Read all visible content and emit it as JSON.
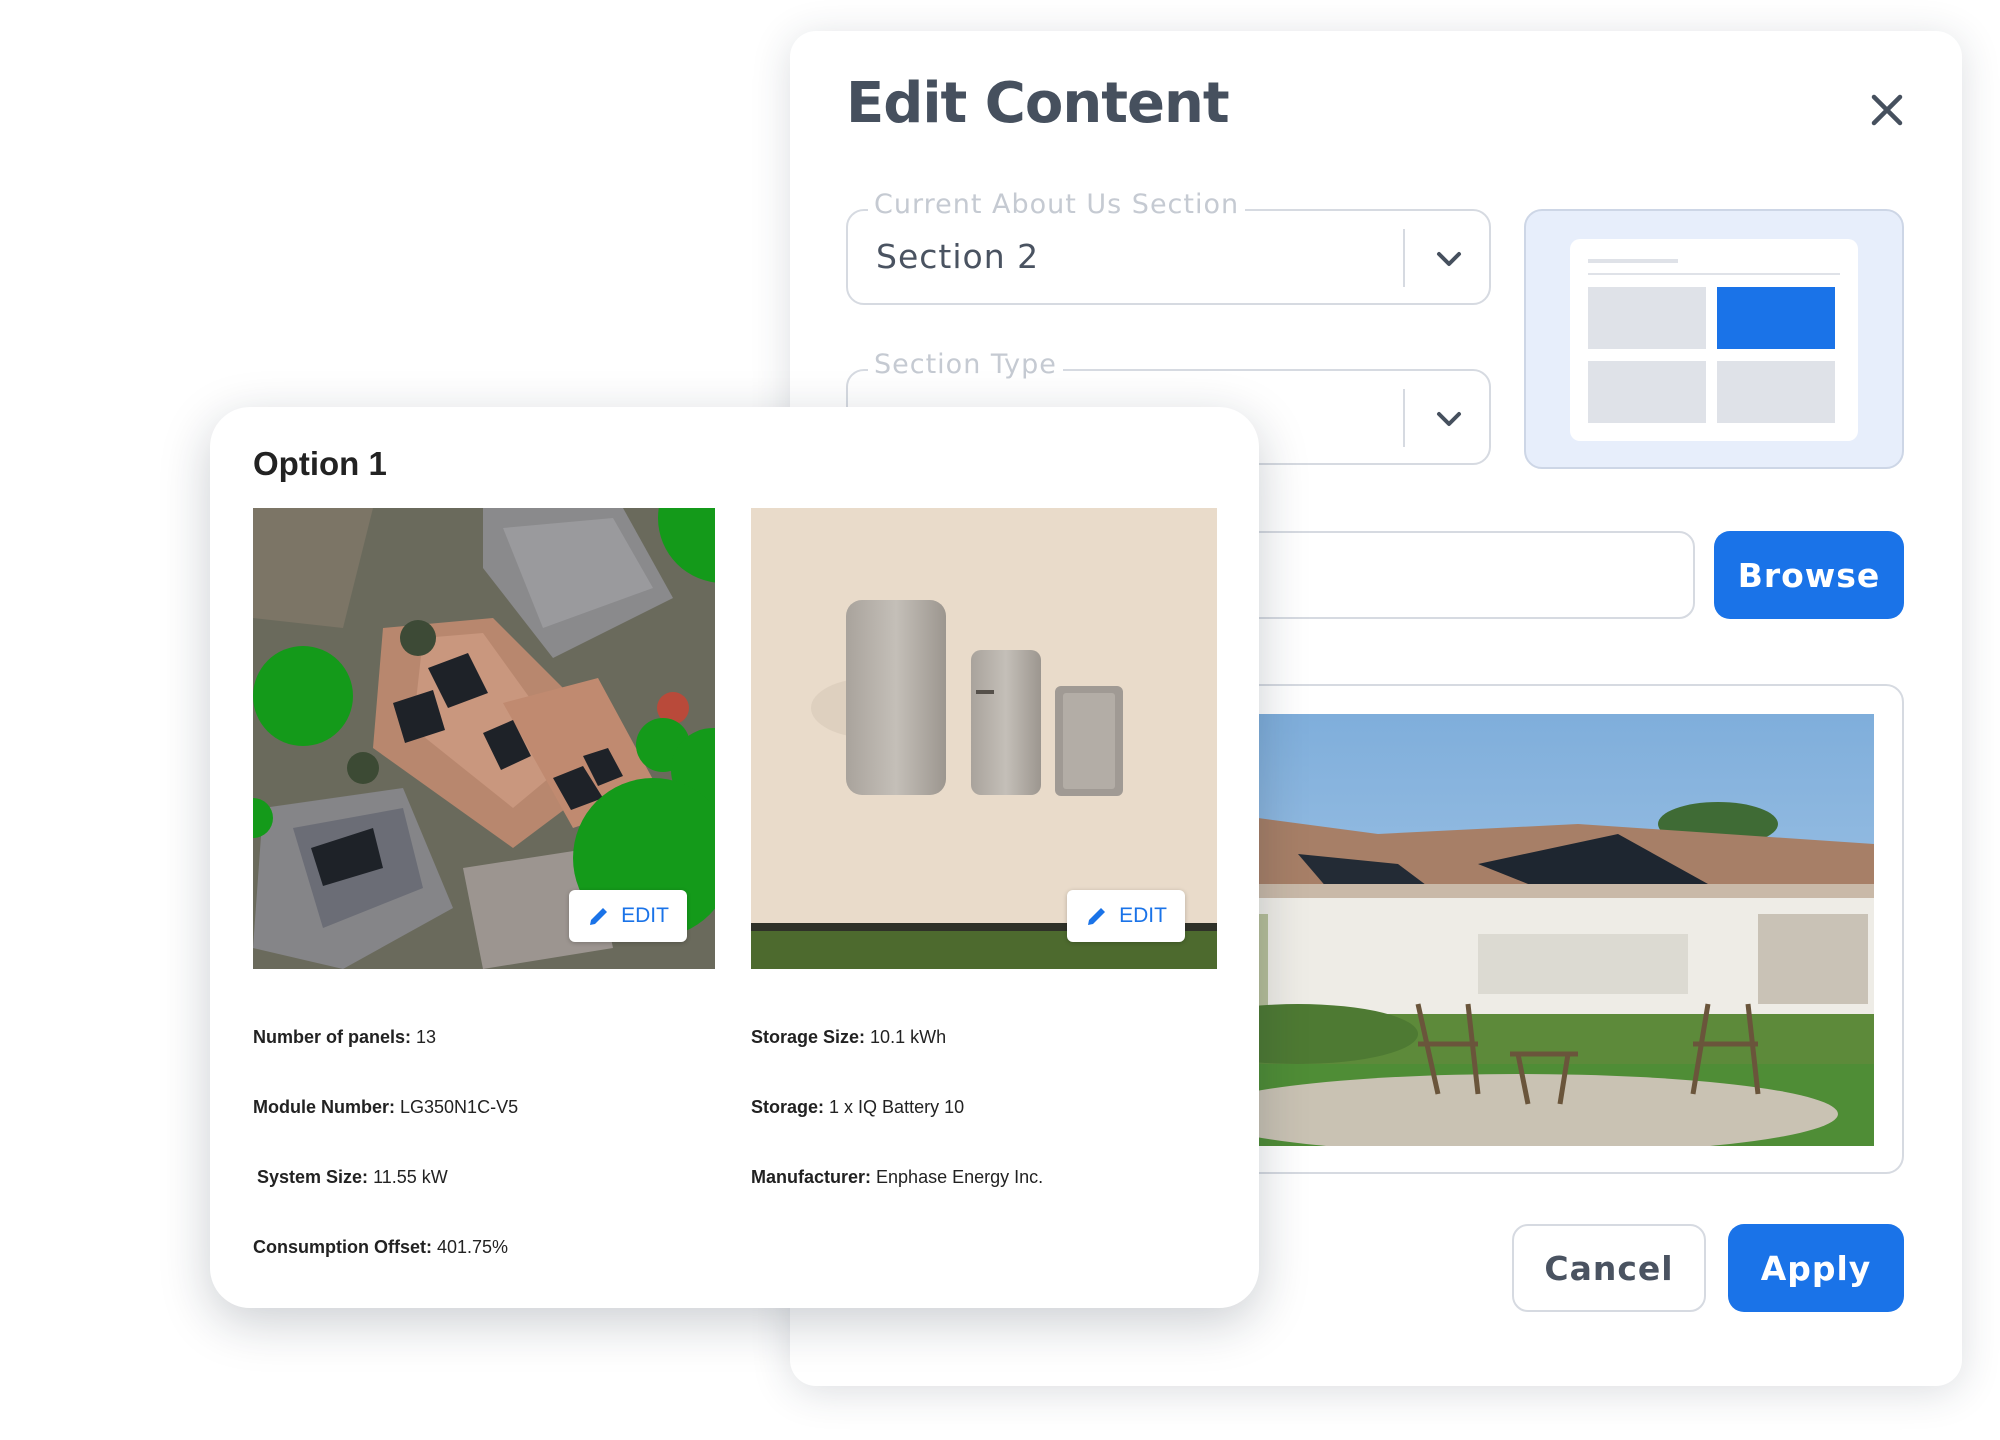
{
  "modal": {
    "title": "Edit Content",
    "current_section": {
      "label": "Current About Us Section",
      "value": "Section 2"
    },
    "section_type": {
      "label": "Section Type",
      "value": ""
    },
    "file_input": {
      "value": ""
    },
    "browse_label": "Browse",
    "cancel_label": "Cancel",
    "apply_label": "Apply",
    "accent_color": "#1a73e8"
  },
  "option": {
    "title": "Option 1",
    "edit_label": "EDIT",
    "specs_left": [
      {
        "label": "Number of panels:",
        "value": "13"
      },
      {
        "label": "Module Number:",
        "value": "LG350N1C-V5"
      },
      {
        "label": "System Size:",
        "value": "11.55 kW"
      },
      {
        "label": "Consumption Offset:",
        "value": "401.75%"
      }
    ],
    "specs_right": [
      {
        "label": "Storage Size:",
        "value": "10.1 kWh"
      },
      {
        "label": "Storage:",
        "value": "1 x IQ Battery 10"
      },
      {
        "label": "Manufacturer:",
        "value": "Enphase Energy Inc."
      }
    ]
  },
  "icons": {
    "close": "close-icon",
    "chevron": "chevron-down-icon",
    "edit": "pencil-icon"
  }
}
